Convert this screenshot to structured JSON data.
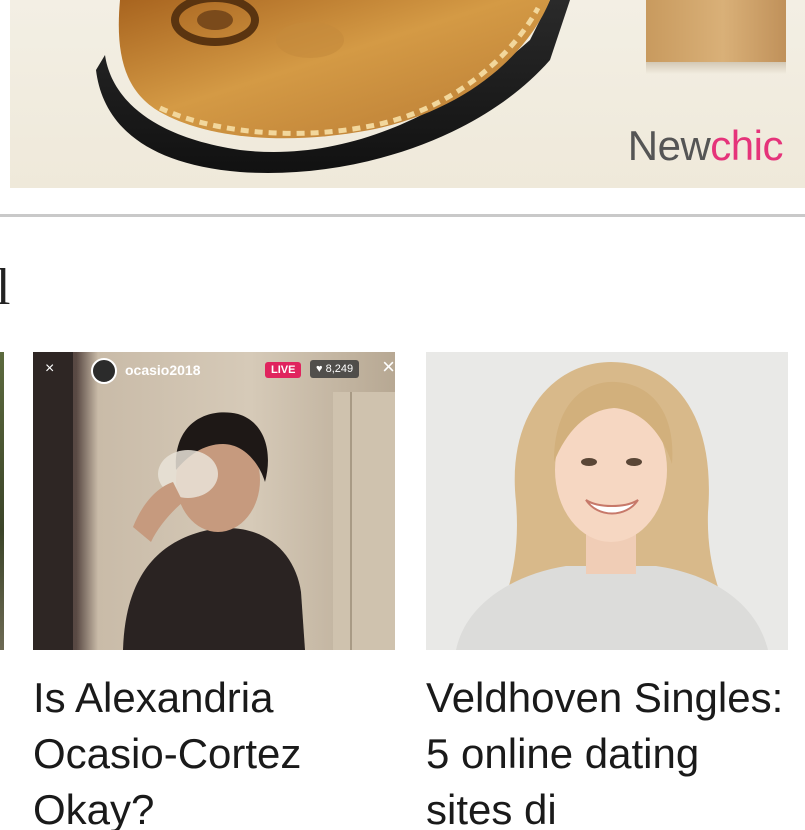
{
  "ad": {
    "brand_prefix": "New",
    "brand_accent": "chic",
    "brand_color": "#555555",
    "accent_color": "#e5337a"
  },
  "section": {
    "title": "l"
  },
  "cards": [
    {
      "title": "Is Alexandria Ocasio-Cortez Okay?",
      "overlay": {
        "username": "ocasio2018",
        "live_label": "LIVE",
        "viewer_count": "8,249",
        "close_glyph": "×",
        "x_glyph": "×"
      }
    },
    {
      "title": "Veldhoven Singles: 5 online dating sites di"
    }
  ]
}
